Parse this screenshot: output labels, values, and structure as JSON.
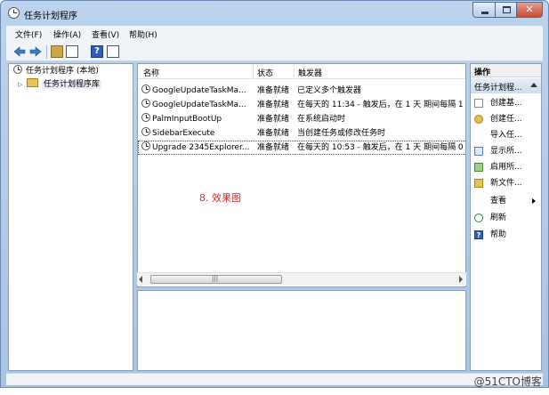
{
  "window": {
    "title": "任务计划程序"
  },
  "menu": {
    "items": [
      "文件(F)",
      "操作(A)",
      "查看(V)",
      "帮助(H)"
    ]
  },
  "tree": {
    "root": "任务计划程序 (本地)",
    "child": "任务计划程序库"
  },
  "list": {
    "columns": [
      "名称",
      "状态",
      "触发器"
    ],
    "rows": [
      {
        "name": "GoogleUpdateTaskMa...",
        "status": "准备就绪",
        "trigger": "已定义多个触发器"
      },
      {
        "name": "GoogleUpdateTaskMa...",
        "status": "准备就绪",
        "trigger": "在每天的 11:34 - 触发后，在 1 天 期间每隔 1"
      },
      {
        "name": "PalmInputBootUp",
        "status": "准备就绪",
        "trigger": "在系统启动时"
      },
      {
        "name": "SidebarExecute",
        "status": "准备就绪",
        "trigger": "当创建任务或修改任务时"
      },
      {
        "name": "Upgrade 2345Explorer...",
        "status": "准备就绪",
        "trigger": "在每天的 10:53 - 触发后，在 1 天 期间每隔 0"
      }
    ]
  },
  "annotation": {
    "label": "8. 效果图"
  },
  "actions": {
    "header": "操作",
    "section": "任务计划程...",
    "items": [
      "创建基...",
      "创建任...",
      "导入任...",
      "显示所...",
      "启用所...",
      "新文件...",
      "查看",
      "刷新",
      "帮助"
    ]
  },
  "watermark": "@51CTO博客",
  "colors": {
    "titlebar": "#bcd3ec",
    "accent_red": "#e0282a",
    "close_button": "#c74a2f"
  }
}
